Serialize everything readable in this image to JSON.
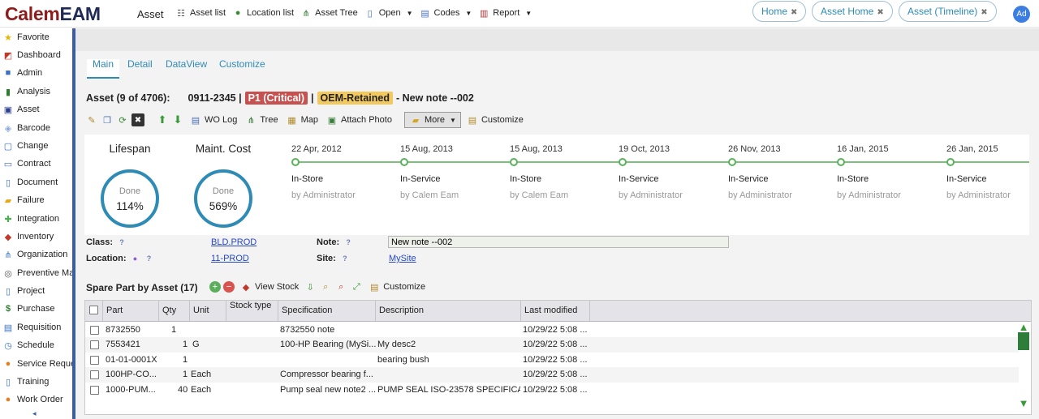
{
  "app": {
    "logo_part1": "Calem",
    "logo_part2": "EAM",
    "title": "Asset",
    "avatar": "Ad",
    "nav": [
      {
        "label": "Asset list",
        "icon": "list-icon"
      },
      {
        "label": "Location list",
        "icon": "globe-icon"
      },
      {
        "label": "Asset Tree",
        "icon": "tree-icon"
      },
      {
        "label": "Open",
        "icon": "document-icon",
        "dropdown": true
      },
      {
        "label": "Codes",
        "icon": "codes-icon",
        "dropdown": true
      },
      {
        "label": "Report",
        "icon": "report-icon",
        "dropdown": true
      }
    ]
  },
  "sidebar": {
    "items": [
      {
        "label": "Favorite",
        "icon": "star-icon",
        "color": "#e8b400"
      },
      {
        "label": "Dashboard",
        "icon": "dashboard-icon",
        "color": "#c0392b"
      },
      {
        "label": "Admin",
        "icon": "admin-icon",
        "color": "#3b6fc8"
      },
      {
        "label": "Analysis",
        "icon": "analysis-icon",
        "color": "#2e7d32"
      },
      {
        "label": "Asset",
        "icon": "asset-icon",
        "color": "#2c3e8c"
      },
      {
        "label": "Barcode",
        "icon": "barcode-icon",
        "color": "#8aa8d8"
      },
      {
        "label": "Change",
        "icon": "change-icon",
        "color": "#3b6fc8"
      },
      {
        "label": "Contract",
        "icon": "contract-icon",
        "color": "#3b6fc8"
      },
      {
        "label": "Document",
        "icon": "document-icon",
        "color": "#3b6fc8"
      },
      {
        "label": "Failure",
        "icon": "failure-icon",
        "color": "#e6a817"
      },
      {
        "label": "Integration",
        "icon": "integration-icon",
        "color": "#4caf50"
      },
      {
        "label": "Inventory",
        "icon": "inventory-icon",
        "color": "#c0392b"
      },
      {
        "label": "Organization",
        "icon": "organization-icon",
        "color": "#4a7fc4"
      },
      {
        "label": "Preventive Ma",
        "icon": "preventive-icon",
        "color": "#555555"
      },
      {
        "label": "Project",
        "icon": "project-icon",
        "color": "#3b6fc8"
      },
      {
        "label": "Purchase",
        "icon": "dollar-icon",
        "color": "#2e7d32"
      },
      {
        "label": "Requisition",
        "icon": "requisition-icon",
        "color": "#3b6fc8"
      },
      {
        "label": "Schedule",
        "icon": "schedule-icon",
        "color": "#3b6fc8"
      },
      {
        "label": "Service Reque",
        "icon": "service-request-icon",
        "color": "#e67e22"
      },
      {
        "label": "Training",
        "icon": "training-icon",
        "color": "#3b6fc8"
      },
      {
        "label": "Work Order",
        "icon": "work-order-icon",
        "color": "#e67e22"
      }
    ],
    "collapse": "◂"
  },
  "page_tabs": [
    {
      "label": "Home"
    },
    {
      "label": "Asset Home"
    },
    {
      "label": "Asset (Timeline)"
    }
  ],
  "sub_tabs": [
    {
      "label": "Main",
      "active": true
    },
    {
      "label": "Detail"
    },
    {
      "label": "DataView"
    },
    {
      "label": "Customize"
    }
  ],
  "header": {
    "counter": "Asset (9 of 4706):",
    "asset_no": "0911-2345 |",
    "priority": "P1 (Critical)",
    "sep": "|",
    "oem": "OEM-Retained",
    "desc": "- New note --002",
    "priority_color": "#c7514f",
    "oem_color": "#f2c95e"
  },
  "toolbar": {
    "wo_log": "WO Log",
    "tree": "Tree",
    "map": "Map",
    "attach_photo": "Attach Photo",
    "more": "More",
    "customize": "Customize"
  },
  "kpis": [
    {
      "title": "Lifespan",
      "status": "Done",
      "value": "114%"
    },
    {
      "title": "Maint. Cost",
      "status": "Done",
      "value": "569%"
    }
  ],
  "timeline": [
    {
      "date": "22 Apr, 2012",
      "status": "In-Store",
      "by": "by Administrator"
    },
    {
      "date": "15 Aug, 2013",
      "status": "In-Service",
      "by": "by Calem Eam"
    },
    {
      "date": "15 Aug, 2013",
      "status": "In-Store",
      "by": "by Calem Eam"
    },
    {
      "date": "19 Oct, 2013",
      "status": "In-Service",
      "by": "by Administrator"
    },
    {
      "date": "26 Nov, 2013",
      "status": "In-Service",
      "by": "by Administrator"
    },
    {
      "date": "16 Jan, 2015",
      "status": "In-Store",
      "by": "by Administrator"
    },
    {
      "date": "26 Jan, 2015",
      "status": "In-Service",
      "by": "by Administrator"
    }
  ],
  "fields": {
    "class_label": "Class:",
    "class_value": "BLD.PROD",
    "location_label": "Location:",
    "location_value": "11-PROD",
    "note_label": "Note:",
    "note_value": "New note --002",
    "site_label": "Site:",
    "site_value": "MySite",
    "help": "?"
  },
  "spare_parts": {
    "title": "Spare Part by Asset (17)",
    "view_stock": "View Stock",
    "customize": "Customize",
    "columns": [
      "Part",
      "Qty",
      "Unit",
      "Stock type",
      "Specification",
      "Description",
      "Last modified"
    ],
    "rows": [
      {
        "part": "8732550",
        "qty": "1",
        "unit": "",
        "stock": "",
        "spec": "8732550 note",
        "desc": "",
        "modified": "10/29/22 5:08 ..."
      },
      {
        "part": "7553421",
        "qty": "1",
        "unit": "G",
        "stock": "",
        "spec": "100-HP Bearing (MySi...",
        "desc": "My desc2",
        "modified": "10/29/22 5:08 ..."
      },
      {
        "part": "01-01-0001X",
        "qty": "1",
        "unit": "",
        "stock": "",
        "spec": "",
        "desc": "bearing bush",
        "modified": "10/29/22 5:08 ..."
      },
      {
        "part": "100HP-CO...",
        "qty": "1",
        "unit": "Each",
        "stock": "",
        "spec": "Compressor bearing f...",
        "desc": "",
        "modified": "10/29/22 5:08 ..."
      },
      {
        "part": "1000-PUM...",
        "qty": "40",
        "unit": "Each",
        "stock": "",
        "spec": "Pump seal new note2 ...",
        "desc": "PUMP SEAL ISO-23578 SPECIFICA...",
        "modified": "10/29/22 5:08 ..."
      }
    ]
  }
}
